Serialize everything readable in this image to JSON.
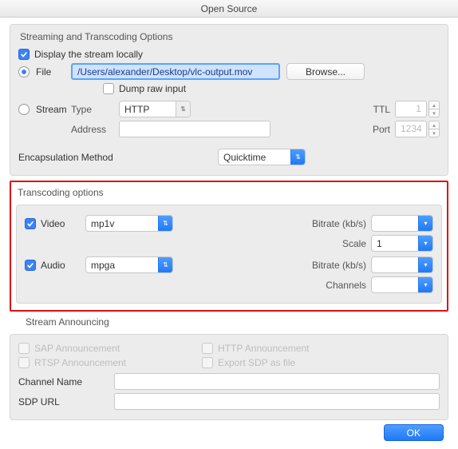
{
  "window": {
    "title": "Open Source"
  },
  "streaming": {
    "header": "Streaming and Transcoding Options",
    "display_locally": "Display the stream locally",
    "file_label": "File",
    "file_path": "/Users/alexander/Desktop/vlc-output.mov",
    "browse": "Browse...",
    "dump_raw": "Dump raw input",
    "stream_label": "Stream",
    "type_label": "Type",
    "type_value": "HTTP",
    "ttl_label": "TTL",
    "ttl_value": "1",
    "address_label": "Address",
    "address_value": "",
    "port_label": "Port",
    "port_placeholder": "1234",
    "encaps_label": "Encapsulation Method",
    "encaps_value": "Quicktime"
  },
  "transcoding": {
    "header": "Transcoding options",
    "video_label": "Video",
    "video_codec": "mp1v",
    "video_bitrate_label": "Bitrate (kb/s)",
    "video_bitrate": "",
    "scale_label": "Scale",
    "scale_value": "1",
    "audio_label": "Audio",
    "audio_codec": "mpga",
    "audio_bitrate_label": "Bitrate (kb/s)",
    "audio_bitrate": "",
    "channels_label": "Channels",
    "channels_value": ""
  },
  "announce": {
    "header": "Stream Announcing",
    "sap": "SAP Announcement",
    "http": "HTTP Announcement",
    "rtsp": "RTSP Announcement",
    "export_sdp": "Export SDP as file",
    "channel_name_label": "Channel Name",
    "channel_name": "",
    "sdp_url_label": "SDP URL",
    "sdp_url": ""
  },
  "buttons": {
    "ok": "OK"
  }
}
